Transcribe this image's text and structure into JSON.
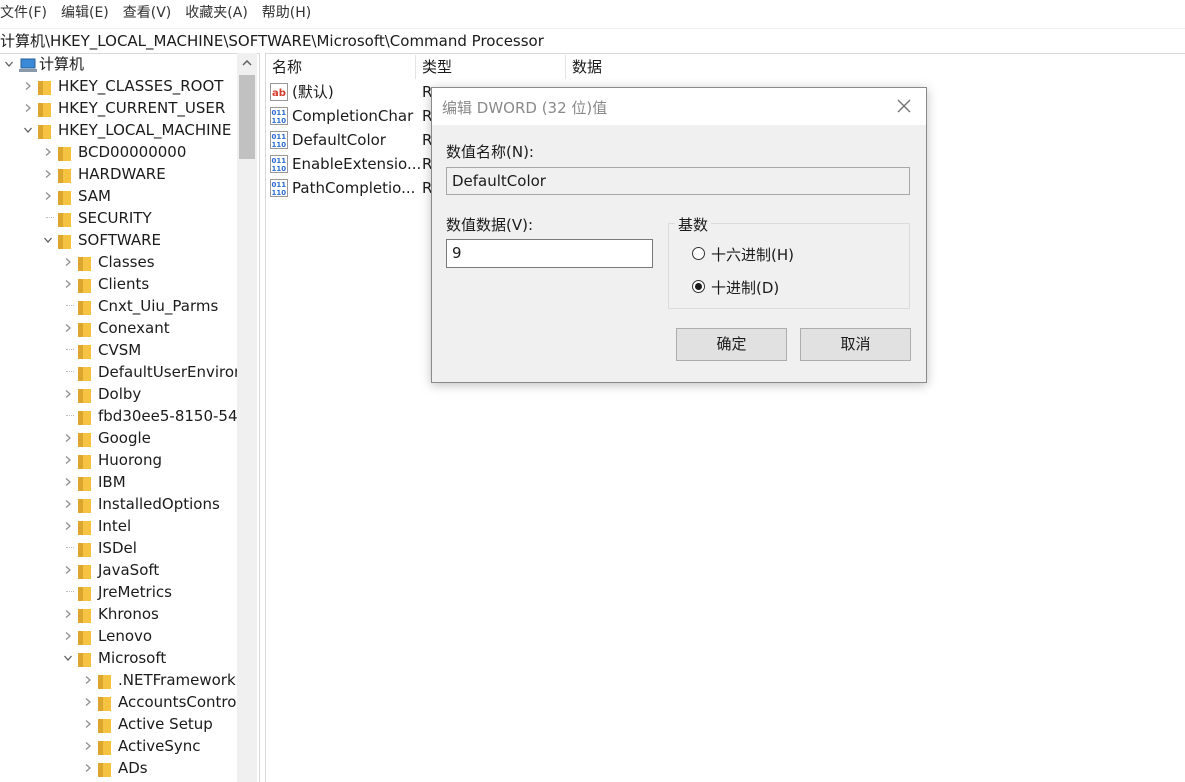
{
  "menu": [
    "文件(F)",
    "编辑(E)",
    "查看(V)",
    "收藏夹(A)",
    "帮助(H)"
  ],
  "address": "计算机\\HKEY_LOCAL_MACHINE\\SOFTWARE\\Microsoft\\Command Processor",
  "tree": [
    {
      "label": "计算机",
      "level": 0,
      "state": "expanded",
      "kind": "computer"
    },
    {
      "label": "HKEY_CLASSES_ROOT",
      "level": 1,
      "state": "collapsed"
    },
    {
      "label": "HKEY_CURRENT_USER",
      "level": 1,
      "state": "collapsed"
    },
    {
      "label": "HKEY_LOCAL_MACHINE",
      "level": 1,
      "state": "expanded"
    },
    {
      "label": "BCD00000000",
      "level": 2,
      "state": "collapsed"
    },
    {
      "label": "HARDWARE",
      "level": 2,
      "state": "collapsed"
    },
    {
      "label": "SAM",
      "level": 2,
      "state": "collapsed"
    },
    {
      "label": "SECURITY",
      "level": 2,
      "state": "leaf"
    },
    {
      "label": "SOFTWARE",
      "level": 2,
      "state": "expanded"
    },
    {
      "label": "Classes",
      "level": 3,
      "state": "collapsed"
    },
    {
      "label": "Clients",
      "level": 3,
      "state": "collapsed"
    },
    {
      "label": "Cnxt_Uiu_Parms",
      "level": 3,
      "state": "leaf"
    },
    {
      "label": "Conexant",
      "level": 3,
      "state": "collapsed"
    },
    {
      "label": "CVSM",
      "level": 3,
      "state": "leaf"
    },
    {
      "label": "DefaultUserEnvironm",
      "level": 3,
      "state": "leaf"
    },
    {
      "label": "Dolby",
      "level": 3,
      "state": "collapsed"
    },
    {
      "label": "fbd30ee5-8150-54",
      "level": 3,
      "state": "leaf"
    },
    {
      "label": "Google",
      "level": 3,
      "state": "collapsed"
    },
    {
      "label": "Huorong",
      "level": 3,
      "state": "collapsed"
    },
    {
      "label": "IBM",
      "level": 3,
      "state": "collapsed"
    },
    {
      "label": "InstalledOptions",
      "level": 3,
      "state": "collapsed"
    },
    {
      "label": "Intel",
      "level": 3,
      "state": "collapsed"
    },
    {
      "label": "ISDel",
      "level": 3,
      "state": "leaf"
    },
    {
      "label": "JavaSoft",
      "level": 3,
      "state": "collapsed"
    },
    {
      "label": "JreMetrics",
      "level": 3,
      "state": "leaf"
    },
    {
      "label": "Khronos",
      "level": 3,
      "state": "collapsed"
    },
    {
      "label": "Lenovo",
      "level": 3,
      "state": "collapsed"
    },
    {
      "label": "Microsoft",
      "level": 3,
      "state": "expanded"
    },
    {
      "label": ".NETFramework",
      "level": 4,
      "state": "collapsed"
    },
    {
      "label": "AccountsControl",
      "level": 4,
      "state": "collapsed"
    },
    {
      "label": "Active Setup",
      "level": 4,
      "state": "collapsed"
    },
    {
      "label": "ActiveSync",
      "level": 4,
      "state": "collapsed"
    },
    {
      "label": "ADs",
      "level": 4,
      "state": "collapsed"
    }
  ],
  "list": {
    "columns": [
      "名称",
      "类型",
      "数据"
    ],
    "rows": [
      {
        "name": "(默认)",
        "type": "R",
        "icon": "string-value-icon"
      },
      {
        "name": "CompletionChar",
        "type": "R",
        "icon": "dword-value-icon"
      },
      {
        "name": "DefaultColor",
        "type": "R",
        "icon": "dword-value-icon"
      },
      {
        "name": "EnableExtensio...",
        "type": "R",
        "icon": "dword-value-icon"
      },
      {
        "name": "PathCompletio...",
        "type": "R",
        "icon": "dword-value-icon"
      }
    ]
  },
  "dialog": {
    "title": "编辑 DWORD (32 位)值",
    "name_label": "数值名称(N):",
    "name_value": "DefaultColor",
    "data_label": "数值数据(V):",
    "data_value": "9",
    "base_label": "基数",
    "radios": [
      {
        "label": "十六进制(H)",
        "checked": false
      },
      {
        "label": "十进制(D)",
        "checked": true
      }
    ],
    "ok": "确定",
    "cancel": "取消"
  },
  "colors": {
    "folder": "#f5c242",
    "folder_dark": "#dca52e",
    "icon_blue": "#2d6bd2",
    "icon_red": "#d43b2a"
  }
}
